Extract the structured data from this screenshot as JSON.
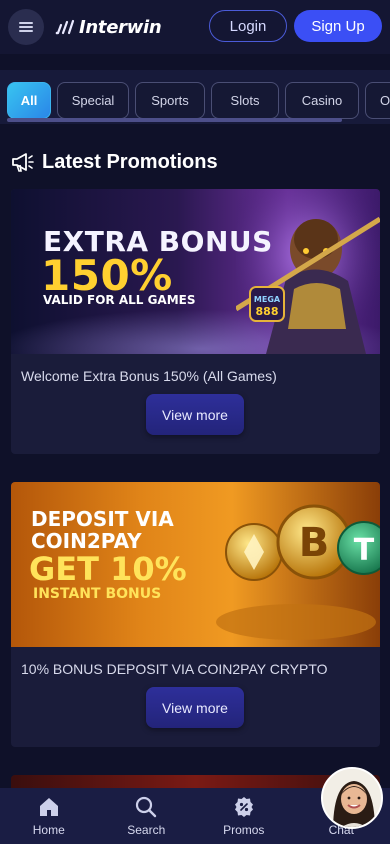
{
  "header": {
    "brand": "Interwin",
    "login_label": "Login",
    "signup_label": "Sign Up"
  },
  "categories": [
    {
      "label": "All",
      "active": true
    },
    {
      "label": "Special",
      "active": false
    },
    {
      "label": "Sports",
      "active": false
    },
    {
      "label": "Slots",
      "active": false
    },
    {
      "label": "Casino",
      "active": false
    },
    {
      "label": "Ot",
      "active": false
    }
  ],
  "section": {
    "title": "Latest Promotions"
  },
  "promos": [
    {
      "banner_line1": "EXTRA BONUS",
      "banner_line2": "150%",
      "banner_line3": "VALID FOR ALL GAMES",
      "badge_top": "MEGA",
      "badge_bottom": "888",
      "caption": "Welcome Extra Bonus 150% (All Games)",
      "button_label": "View more"
    },
    {
      "banner_line1": "DEPOSIT VIA",
      "banner_line2": "COIN2PAY",
      "banner_line3": "GET 10%",
      "banner_line4": "INSTANT BONUS",
      "caption": "10% BONUS DEPOSIT VIA COIN2PAY CRYPTO",
      "button_label": "View more"
    }
  ],
  "bottom_nav": [
    {
      "label": "Home",
      "icon": "home-icon"
    },
    {
      "label": "Search",
      "icon": "search-icon"
    },
    {
      "label": "Promos",
      "icon": "promos-icon"
    },
    {
      "label": "Chat",
      "icon": "chat-icon"
    }
  ],
  "colors": {
    "background": "#0f1129",
    "accent": "#3b4ff5",
    "active_chip": "#38c4f0",
    "banner1_yellow": "#ffd030",
    "banner2_orange": "#e08418"
  }
}
